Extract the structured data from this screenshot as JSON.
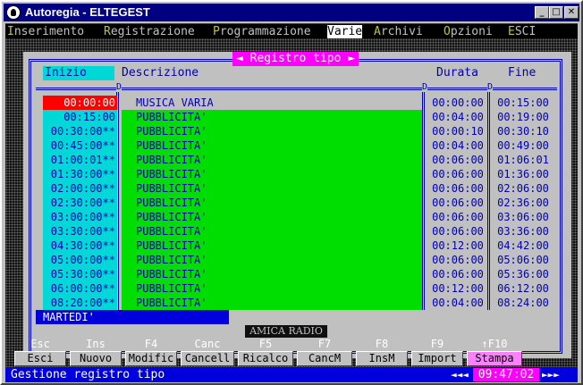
{
  "window": {
    "title": "Autoregia - ELTEGEST"
  },
  "menu": [
    {
      "hotkey": "I",
      "rest": "nserimento"
    },
    {
      "hotkey": "R",
      "rest": "egistrazione"
    },
    {
      "hotkey": "P",
      "rest": "rogrammazione"
    },
    {
      "hotkey": "",
      "rest": "Varie"
    },
    {
      "hotkey": "A",
      "rest": "rchivi"
    },
    {
      "hotkey": "O",
      "rest": "pzioni"
    },
    {
      "hotkey": "E",
      "rest": "SCI"
    }
  ],
  "panel": {
    "title": "◄ Registro tipo ►",
    "headers": {
      "start": "Inizio",
      "desc": "Descrizione",
      "duration": "Durata",
      "end": "Fine"
    },
    "sep_mark": "D",
    "rows": [
      {
        "start": "00:00:00",
        "desc": "MUSICA VARIA",
        "duration": "00:00:00",
        "end": "00:15:00"
      },
      {
        "start": "00:15:00",
        "desc": "PUBBLICITA'",
        "duration": "00:04:00",
        "end": "00:19:00"
      },
      {
        "start": "00:30:00**",
        "desc": "PUBBLICITA'",
        "duration": "00:00:10",
        "end": "00:30:10"
      },
      {
        "start": "00:45:00**",
        "desc": "PUBBLICITA'",
        "duration": "00:04:00",
        "end": "00:49:00"
      },
      {
        "start": "01:00:01**",
        "desc": "PUBBLICITA'",
        "duration": "00:06:00",
        "end": "01:06:01"
      },
      {
        "start": "01:30:00**",
        "desc": "PUBBLICITA'",
        "duration": "00:06:00",
        "end": "01:36:00"
      },
      {
        "start": "02:00:00**",
        "desc": "PUBBLICITA'",
        "duration": "00:06:00",
        "end": "02:06:00"
      },
      {
        "start": "02:30:00**",
        "desc": "PUBBLICITA'",
        "duration": "00:06:00",
        "end": "02:36:00"
      },
      {
        "start": "03:00:00**",
        "desc": "PUBBLICITA'",
        "duration": "00:06:00",
        "end": "03:06:00"
      },
      {
        "start": "03:30:00**",
        "desc": "PUBBLICITA'",
        "duration": "00:06:00",
        "end": "03:36:00"
      },
      {
        "start": "04:30:00**",
        "desc": "PUBBLICITA'",
        "duration": "00:12:00",
        "end": "04:42:00"
      },
      {
        "start": "05:00:00**",
        "desc": "PUBBLICITA'",
        "duration": "00:06:00",
        "end": "05:06:00"
      },
      {
        "start": "05:30:00**",
        "desc": "PUBBLICITA'",
        "duration": "00:06:00",
        "end": "05:36:00"
      },
      {
        "start": "06:00:00**",
        "desc": "PUBBLICITA'",
        "duration": "00:12:00",
        "end": "06:12:00"
      },
      {
        "start": "08:20:00**",
        "desc": "PUBBLICITA'",
        "duration": "00:04:00",
        "end": "08:24:00"
      }
    ],
    "day": "MARTEDI'"
  },
  "station": "AMICA RADIO",
  "fkeys": [
    {
      "key": "Esc",
      "label": "Esci"
    },
    {
      "key": "Ins",
      "label": "Nuovo"
    },
    {
      "key": "F4",
      "label": "Modific"
    },
    {
      "key": "Canc",
      "label": "Cancell"
    },
    {
      "key": "F5",
      "label": "Ricalco"
    },
    {
      "key": "F7",
      "label": "CancM"
    },
    {
      "key": "F8",
      "label": "InsM"
    },
    {
      "key": "F9",
      "label": "Import"
    },
    {
      "key": "↑F10",
      "label": "Stampa"
    }
  ],
  "status": {
    "message": "Gestione registro tipo",
    "time": "09:47:02",
    "left_arrows": "◄◄◄",
    "right_arrows": "►►►"
  },
  "colors": {
    "title_bar": "#000080",
    "highlight": "#ff00ff",
    "desc_bg": "#00dd00",
    "start_bg": "#00d8d8",
    "selected": "#ff0000"
  }
}
